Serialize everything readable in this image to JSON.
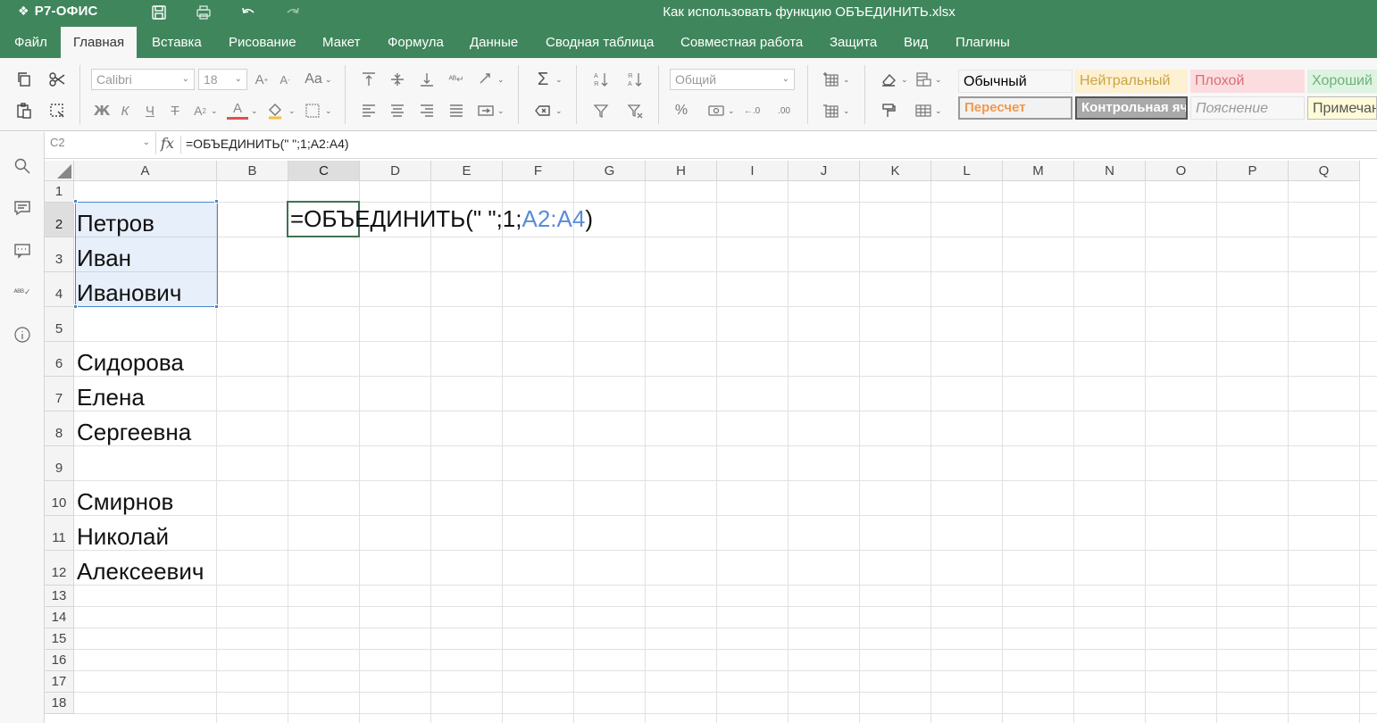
{
  "app": {
    "brand": "Р7-ОФИС",
    "doc_title": "Как использовать функцию ОБЪЕДИНИТЬ.xlsx"
  },
  "menu": {
    "tabs": [
      "Файл",
      "Главная",
      "Вставка",
      "Рисование",
      "Макет",
      "Формула",
      "Данные",
      "Сводная таблица",
      "Совместная работа",
      "Защита",
      "Вид",
      "Плагины"
    ],
    "active": "Главная"
  },
  "toolbar": {
    "font_name": "Calibri",
    "font_size": "18",
    "number_format": "Общий",
    "styles": [
      {
        "label": "Обычный",
        "bg": "#ffffff",
        "fg": "#444444"
      },
      {
        "label": "Нейтральный",
        "bg": "#fdf0d3",
        "fg": "#c9a545"
      },
      {
        "label": "Плохой",
        "bg": "#fbdde0",
        "fg": "#d86d76"
      },
      {
        "label": "Хороший",
        "bg": "#def3e1",
        "fg": "#6fb27a"
      },
      {
        "label": "Пересчет",
        "bg": "#f2f2f2",
        "fg": "#f09950"
      },
      {
        "label": "Контрольная ячейка",
        "bg": "#a9a9a9",
        "fg": "#ffffff"
      },
      {
        "label": "Пояснение",
        "bg": "#ffffff",
        "fg": "#9a9a9a"
      },
      {
        "label": "Примечание",
        "bg": "#fefbd9",
        "fg": "#555555"
      }
    ]
  },
  "formula_bar": {
    "name_box": "C2",
    "fx_label": "fx",
    "formula": "=ОБЪЕДИНИТЬ(\" \";1;A2:A4)"
  },
  "grid": {
    "columns": [
      "A",
      "B",
      "C",
      "D",
      "E",
      "F",
      "G",
      "H",
      "I",
      "J",
      "K",
      "L",
      "M",
      "N",
      "O",
      "P",
      "Q"
    ],
    "rows": [
      "1",
      "2",
      "3",
      "4",
      "5",
      "6",
      "7",
      "8",
      "9",
      "10",
      "11",
      "12",
      "13",
      "14",
      "15",
      "16",
      "17",
      "18"
    ],
    "selected_column": "C",
    "selected_row": "2",
    "cells_A": {
      "A2": "Петров",
      "A3": "Иван",
      "A4": "Иванович",
      "A6": "Сидорова",
      "A7": "Елена",
      "A8": "Сергеевна",
      "A10": "Смирнов",
      "A11": "Николай",
      "A12": "Алексеевич"
    },
    "edit": {
      "prefix": "=ОБЪЕДИНИТЬ(\" \";1;",
      "ref": "A2:A4",
      "suffix": ")",
      "ref_color": "#5b8bd8"
    }
  },
  "colors": {
    "brand_green": "#40865c",
    "selection_blue": "#4a86c8"
  }
}
